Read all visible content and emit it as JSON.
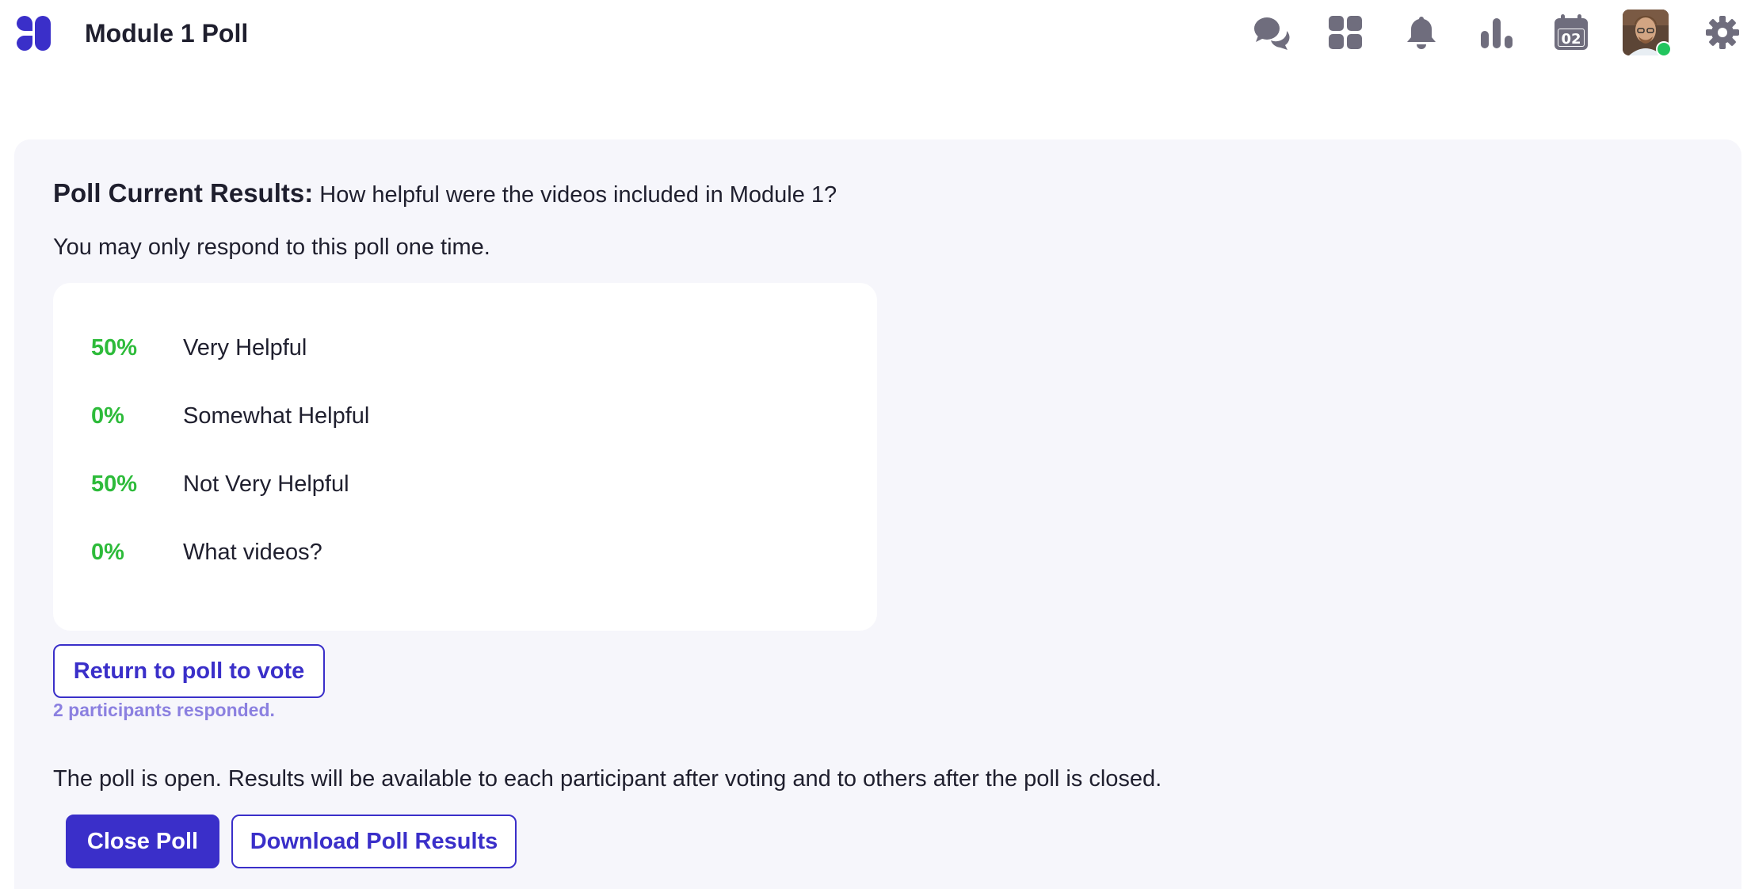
{
  "header": {
    "title": "Module 1 Poll",
    "icons": [
      "chat-icon",
      "apps-grid-icon",
      "bell-icon",
      "stats-icon",
      "calendar-icon",
      "avatar",
      "gear-icon"
    ],
    "calendar_day": "02",
    "icon_color": "#6f6d7d",
    "brand_color": "#3a2fc9",
    "online_color": "#22c55e"
  },
  "poll": {
    "heading_label": "Poll Current Results:",
    "question": "How helpful were the videos included in Module 1?",
    "note": "You may only respond to this poll one time.",
    "results": [
      {
        "percent": "50%",
        "option": "Very Helpful"
      },
      {
        "percent": "0%",
        "option": "Somewhat Helpful"
      },
      {
        "percent": "50%",
        "option": "Not Very Helpful"
      },
      {
        "percent": "0%",
        "option": "What videos?"
      }
    ],
    "percent_color": "#2dbb3a",
    "return_button": "Return to poll to vote",
    "participants": "2 participants responded.",
    "status": "The poll is open. Results will be available to each participant after voting and to others after the poll is closed.",
    "close_button": "Close Poll",
    "download_button": "Download Poll Results"
  }
}
